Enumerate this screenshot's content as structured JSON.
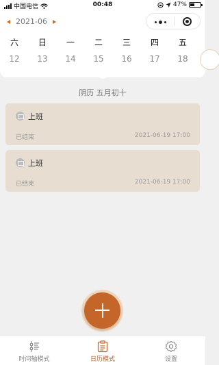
{
  "status_bar": {
    "carrier": "中国电信",
    "time": "00:48",
    "battery": "47%"
  },
  "month_nav": {
    "label": "2021-06"
  },
  "calendar": {
    "weekdays": [
      "六",
      "日",
      "一",
      "二",
      "三",
      "四",
      "五"
    ],
    "dates": [
      "12",
      "13",
      "14",
      "15",
      "16",
      "17",
      "18"
    ]
  },
  "lunar_date": "阴历 五月初十",
  "events": [
    {
      "title": "上班",
      "status": "已结束",
      "time": "2021-06-19 17:00"
    },
    {
      "title": "上班",
      "status": "已结束",
      "time": "2021-06-19 17:00"
    }
  ],
  "tabbar": {
    "items": [
      {
        "label": "时间轴模式",
        "icon": "timeline-icon"
      },
      {
        "label": "日历模式",
        "icon": "calendar-icon",
        "active": true
      },
      {
        "label": "设置",
        "icon": "settings-icon"
      }
    ]
  },
  "colors": {
    "accent": "#c4662a",
    "event_card": "#e7ddd1",
    "background": "#f0f0f0"
  }
}
